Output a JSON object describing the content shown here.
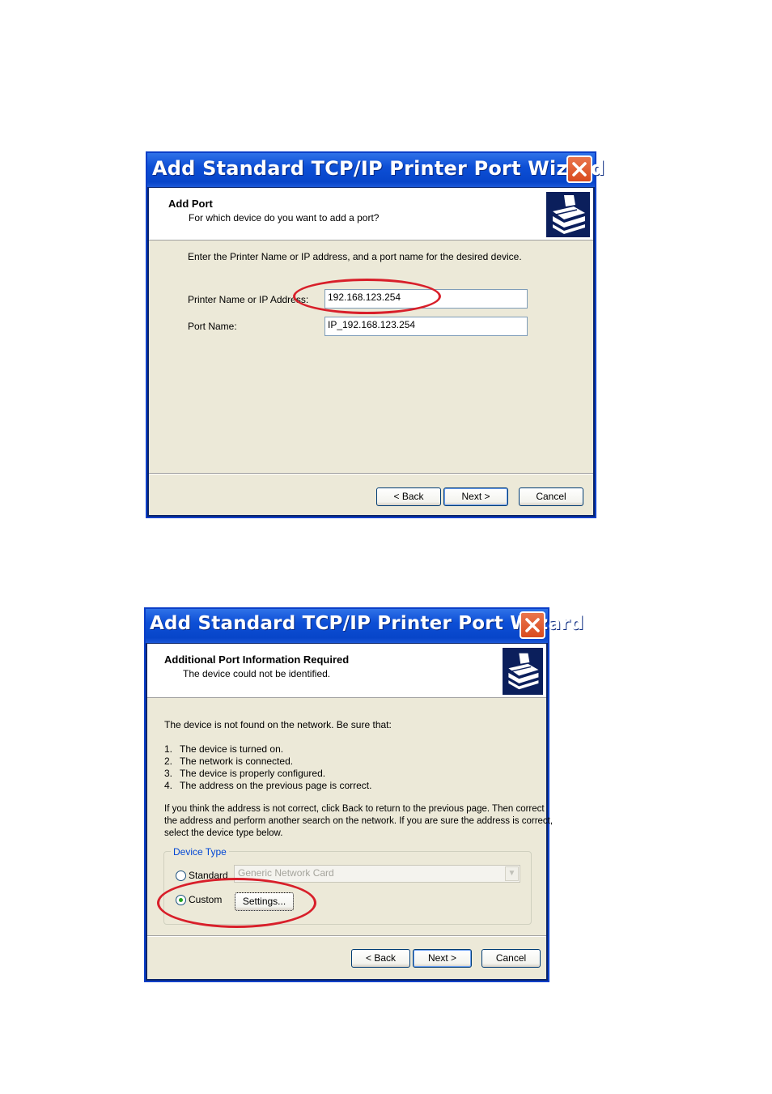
{
  "dialog1": {
    "title": "Add Standard TCP/IP Printer Port Wizard",
    "header_title": "Add Port",
    "header_subtitle": "For which device do you want to add a port?",
    "instructions": "Enter the Printer Name or IP address, and a port name for the desired device.",
    "printer_name_label": "Printer Name or IP Address:",
    "printer_name_value": "192.168.123.254",
    "port_name_label": "Port Name:",
    "port_name_value": "IP_192.168.123.254",
    "buttons": {
      "back": "< Back",
      "next": "Next >",
      "cancel": "Cancel"
    }
  },
  "dialog2": {
    "title": "Add Standard TCP/IP Printer Port Wizard",
    "header_title": "Additional Port Information Required",
    "header_subtitle": "The device could not be identified.",
    "intro": "The device is not found on the network.  Be sure that:",
    "checklist": [
      {
        "num": "1.",
        "text": "The device is turned on."
      },
      {
        "num": "2.",
        "text": "The network is connected."
      },
      {
        "num": "3.",
        "text": "The device is properly configured."
      },
      {
        "num": "4.",
        "text": "The address on the previous page is correct."
      }
    ],
    "paragraph_lines": [
      "If you think the address is not correct, click Back to return to the previous page.  Then correct",
      "the address and perform another search on the network.  If you are sure the address is correct,",
      "select the device type below."
    ],
    "device_type_label": "Device Type",
    "standard_label": "Standard",
    "standard_combo_value": "Generic Network Card",
    "custom_label": "Custom",
    "settings_button": "Settings...",
    "selected_option": "Custom",
    "buttons": {
      "back": "< Back",
      "next": "Next >",
      "cancel": "Cancel"
    }
  },
  "colors": {
    "titlebar": "#0d4fd6",
    "annotation": "#d81f2a",
    "dialog_bg": "#ece9d8"
  },
  "icons": [
    "close-icon",
    "printer-wizard-icon"
  ]
}
